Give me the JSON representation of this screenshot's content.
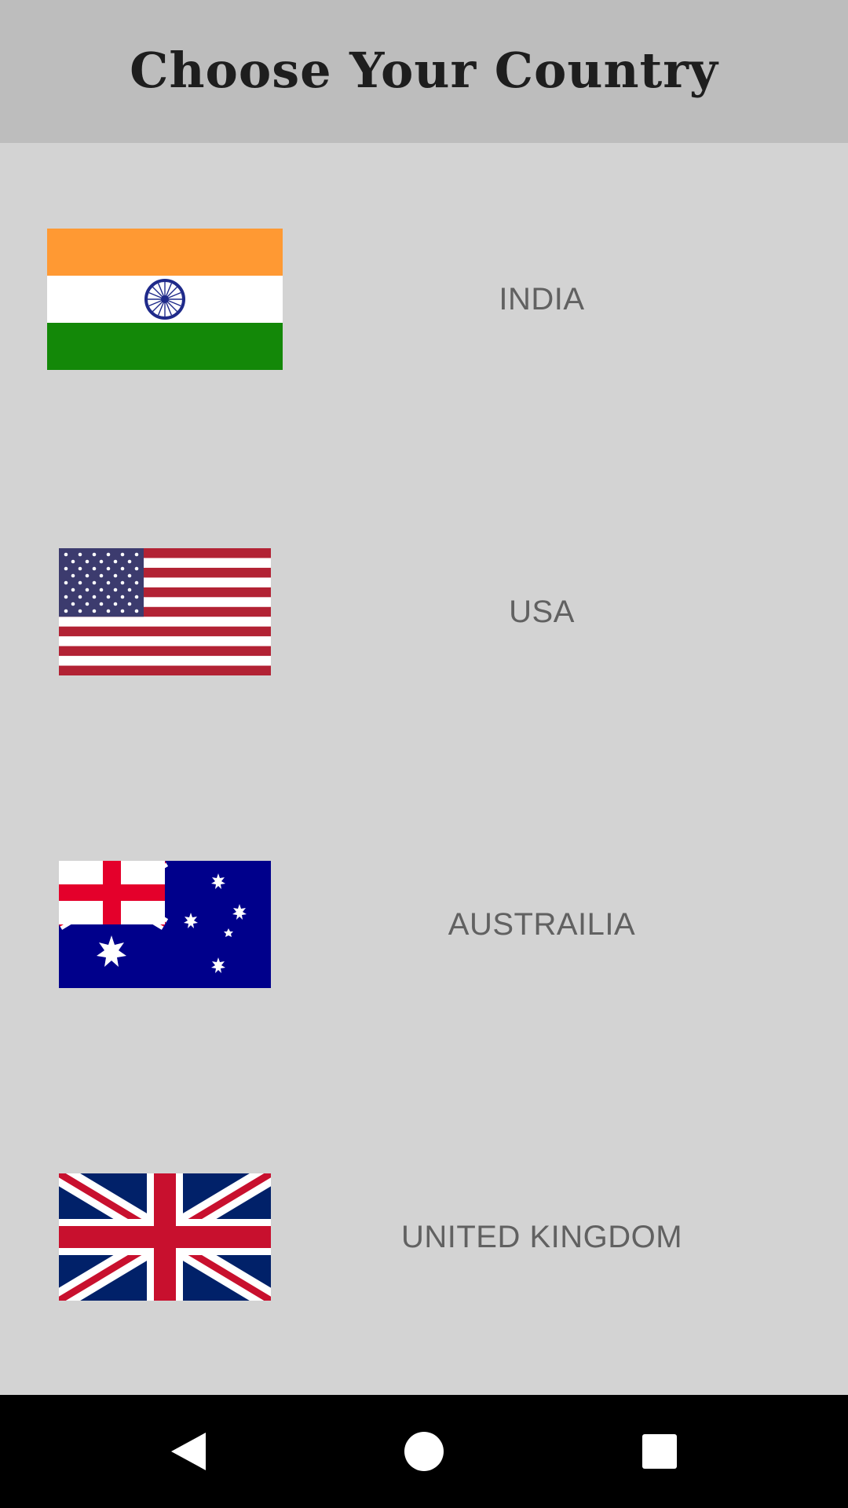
{
  "app_bar": {
    "title": "Choose Your Country"
  },
  "countries": [
    {
      "name": "INDIA",
      "flag_icon": "india-flag-icon"
    },
    {
      "name": "USA",
      "flag_icon": "usa-flag-icon"
    },
    {
      "name": "AUSTRAILIA",
      "flag_icon": "australia-flag-icon"
    },
    {
      "name": "UNITED KINGDOM",
      "flag_icon": "uk-flag-icon"
    }
  ],
  "nav_bar": {
    "back_icon": "back-triangle-icon",
    "home_icon": "home-circle-icon",
    "recents_icon": "recents-square-icon"
  },
  "colors": {
    "app_bar_bg": "#bdbdbd",
    "content_bg": "#d3d3d3",
    "label_text": "#616161",
    "nav_bar_bg": "#000000"
  }
}
